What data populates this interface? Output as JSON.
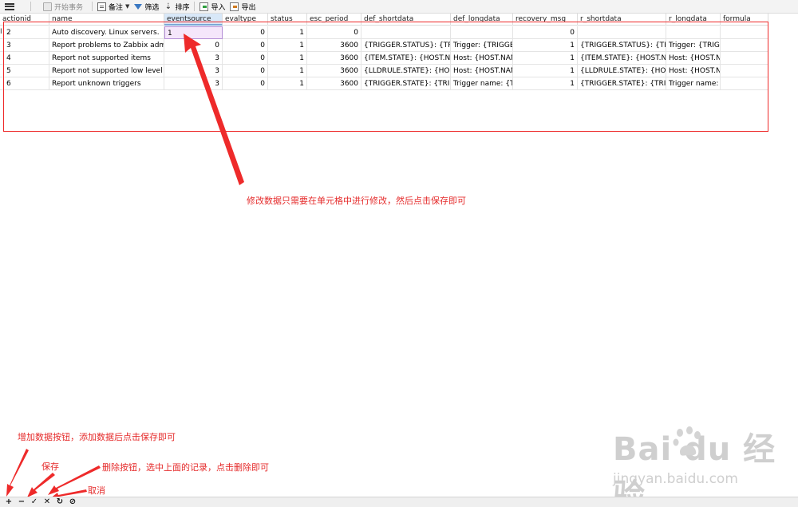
{
  "toolbar": {
    "begin_transaction": "开始事务",
    "memo": "备注",
    "filter": "筛选",
    "sort": "排序",
    "import": "导入",
    "export": "导出"
  },
  "grid": {
    "columns": [
      "actionid",
      "name",
      "eventsource",
      "evaltype",
      "status",
      "esc_period",
      "def_shortdata",
      "def_longdata",
      "recovery_msg",
      "r_shortdata",
      "r_longdata",
      "formula"
    ],
    "selected_column": "eventsource",
    "rows": [
      [
        "2",
        "Auto discovery. Linux servers.",
        "1",
        "0",
        "1",
        "0",
        "",
        "",
        "0",
        "",
        "",
        ""
      ],
      [
        "3",
        "Report problems to Zabbix admi",
        "0",
        "0",
        "1",
        "3600",
        "{TRIGGER.STATUS}: {TRIG",
        "Trigger: {TRIGGER",
        "1",
        "{TRIGGER.STATUS}: {TRIG",
        "Trigger: {TRIGG",
        ""
      ],
      [
        "4",
        "Report not supported items",
        "3",
        "0",
        "1",
        "3600",
        "{ITEM.STATE}: {HOST.NAM",
        "Host: {HOST.NAM",
        "1",
        "{ITEM.STATE}: {HOST.NAM",
        "Host: {HOST.NA",
        ""
      ],
      [
        "5",
        "Report not supported low level d",
        "3",
        "0",
        "1",
        "3600",
        "{LLDRULE.STATE}: {HOST.I",
        "Host: {HOST.NAM",
        "1",
        "{LLDRULE.STATE}: {HOST.I",
        "Host: {HOST.NA",
        ""
      ],
      [
        "6",
        "Report unknown triggers",
        "3",
        "0",
        "1",
        "3600",
        "{TRIGGER.STATE}: {TRIGG",
        "Trigger name: {TR",
        "1",
        "{TRIGGER.STATE}: {TRIGG",
        "Trigger name: {",
        ""
      ]
    ],
    "current_row_marker": "I"
  },
  "annotations": {
    "edit_note": "修改数据只需要在单元格中进行修改，然后点击保存即可",
    "add_note": "增加数据按钮，添加数据后点击保存即可",
    "save_note": "保存",
    "delete_note": "删除按钮，选中上面的记录，点击删除即可",
    "cancel_note": "取消",
    "color": "#e52b2b"
  },
  "bottom_bar": {
    "add": "+",
    "delete": "−",
    "save": "✓",
    "cancel": "✕",
    "refresh": "↻",
    "stop": "⊘"
  },
  "watermark": {
    "logo": "Bai du 经验",
    "url": "jingyan.baidu.com"
  }
}
